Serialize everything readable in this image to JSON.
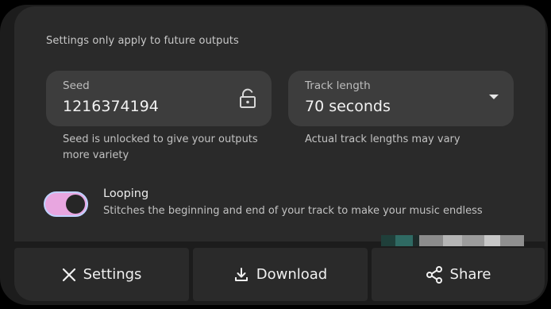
{
  "settings_panel": {
    "hint": "Settings only apply to future outputs",
    "seed": {
      "label": "Seed",
      "value": "1216374194",
      "lock_icon": "lock-open-icon",
      "help": "Seed is unlocked to give your outputs more variety"
    },
    "track_length": {
      "label": "Track length",
      "selected": "70 seconds",
      "help": "Actual track lengths may vary"
    },
    "looping": {
      "title": "Looping",
      "description": "Stitches the beginning and end of your track to make your music endless",
      "enabled": true
    }
  },
  "actions": {
    "settings_label": "Settings",
    "download_label": "Download",
    "share_label": "Share"
  },
  "icons": {
    "settings": "close-icon",
    "download": "download-icon",
    "share": "share-icon"
  },
  "colors": {
    "background": "#000000",
    "card": "#1c1c1c",
    "panel": "#2a2a2a",
    "field": "#3d3d3d",
    "toggle_track": "#e8a6e0",
    "toggle_outline": "#bfd2ff"
  }
}
